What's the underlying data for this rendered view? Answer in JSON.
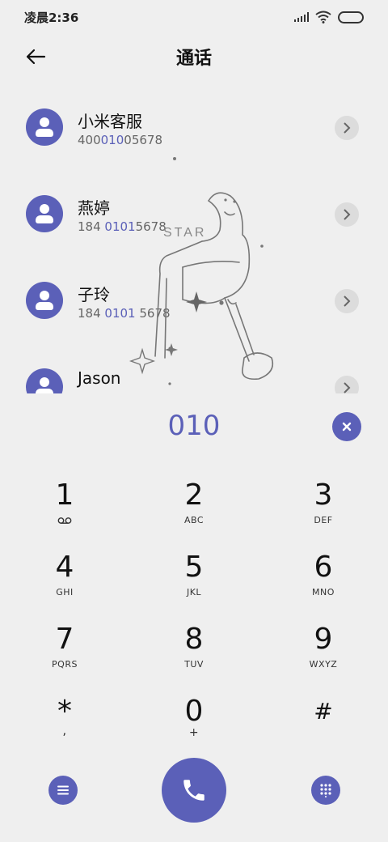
{
  "status_bar": {
    "time": "凌晨2:36"
  },
  "header": {
    "title": "通话"
  },
  "contacts": [
    {
      "name": "小米客服",
      "number_pre": "400",
      "number_match": "010",
      "number_post": "05678"
    },
    {
      "name": "燕婷",
      "number_pre": "184 ",
      "number_match": "0101",
      "number_post": "5678"
    },
    {
      "name": "子玲",
      "number_pre": "184 ",
      "number_match": "0101",
      "number_post": " 5678"
    },
    {
      "name": "Jason",
      "number_pre": "",
      "number_match": "",
      "number_post": ""
    }
  ],
  "dialer": {
    "number": "010"
  },
  "keypad": [
    {
      "digit": "1",
      "letters": "",
      "icon": "voicemail-icon"
    },
    {
      "digit": "2",
      "letters": "ABC"
    },
    {
      "digit": "3",
      "letters": "DEF"
    },
    {
      "digit": "4",
      "letters": "GHI"
    },
    {
      "digit": "5",
      "letters": "JKL"
    },
    {
      "digit": "6",
      "letters": "MNO"
    },
    {
      "digit": "7",
      "letters": "PQRS"
    },
    {
      "digit": "8",
      "letters": "TUV"
    },
    {
      "digit": "9",
      "letters": "WXYZ"
    },
    {
      "digit": "*",
      "letters": ","
    },
    {
      "digit": "0",
      "letters": "+"
    },
    {
      "digit": "#",
      "letters": ""
    }
  ],
  "illustration": {
    "text": "STAR"
  },
  "colors": {
    "accent": "#5b60b8",
    "background": "#efefef",
    "chevron_bg": "#dcdcdc"
  }
}
